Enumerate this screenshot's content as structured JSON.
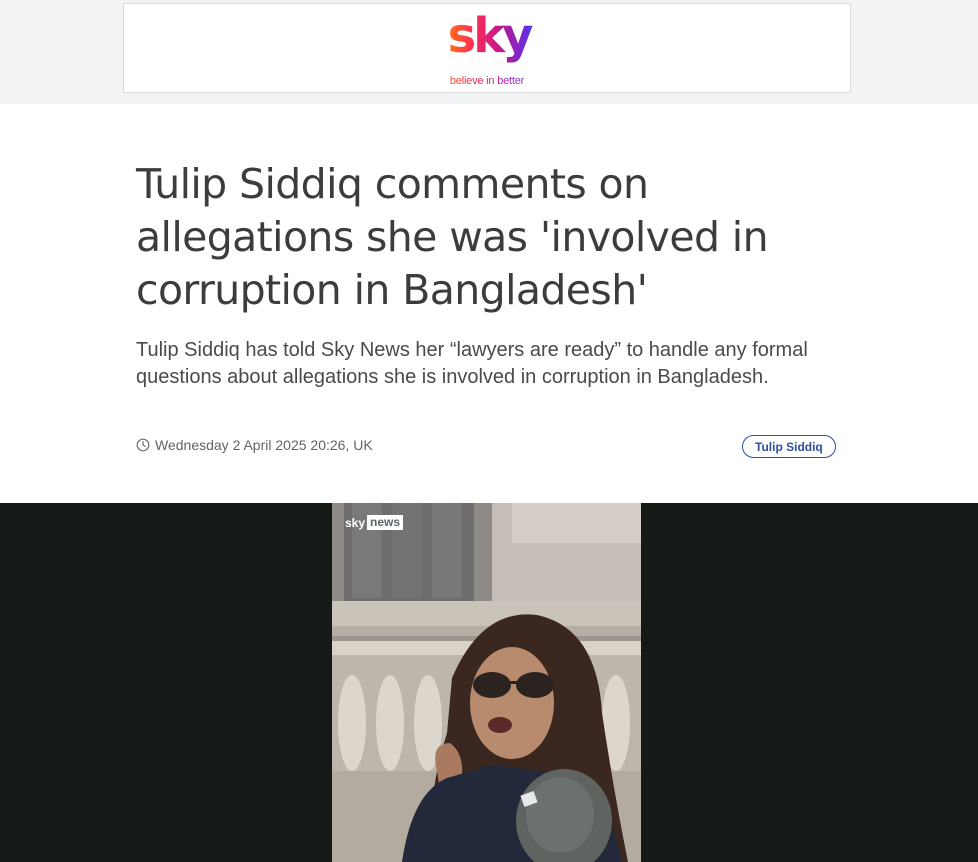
{
  "ad": {
    "logo_text": "sky",
    "tagline": "believe in better"
  },
  "article": {
    "headline": "Tulip Siddiq comments on allegations she was 'involved in corruption in Bangladesh'",
    "standfirst": "Tulip Siddiq has told Sky News her “lawyers are ready” to handle any formal questions about allegations she is involved in corruption in Bangladesh.",
    "timestamp": "Wednesday 2 April 2025 20:26, UK",
    "tag": "Tulip Siddiq"
  },
  "video": {
    "watermark_brand": "sky",
    "watermark_channel": "news"
  },
  "icons": {
    "timestamp": "clock-icon"
  },
  "colors": {
    "tag_accent": "#2b4ea0",
    "video_background": "#151a17"
  }
}
